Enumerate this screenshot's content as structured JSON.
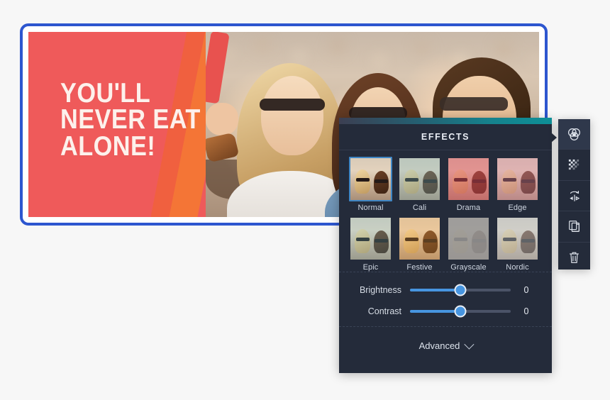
{
  "banner": {
    "headline_lines": [
      "YOU'LL",
      "NEVER EAT",
      "ALONE!"
    ],
    "border_color": "#2d56cf",
    "background_color": "#ef5a5a",
    "stripe_color": "#f47536"
  },
  "effects_panel": {
    "title": "EFFECTS",
    "selected_effect": "Normal",
    "effects": [
      {
        "label": "Normal",
        "tint": "rgba(255,255,255,0)",
        "selected": true
      },
      {
        "label": "Cali",
        "tint": "rgba(120,190,200,0.30)",
        "selected": false
      },
      {
        "label": "Drama",
        "tint": "rgba(224,70,90,0.45)",
        "selected": false
      },
      {
        "label": "Edge",
        "tint": "rgba(215,130,160,0.38)",
        "selected": false
      },
      {
        "label": "Epic",
        "tint": "rgba(110,200,220,0.22)",
        "selected": false
      },
      {
        "label": "Festive",
        "tint": "rgba(255,170,60,0.26)",
        "selected": false
      },
      {
        "label": "Grayscale",
        "tint": "rgba(150,150,150,0.88)",
        "selected": false
      },
      {
        "label": "Nordic",
        "tint": "rgba(180,200,215,0.42)",
        "selected": false
      }
    ],
    "partial_row": [
      {
        "tint": "rgba(190,205,220,0.55)"
      },
      {
        "tint": "rgba(255,205,120,0.48)"
      },
      {
        "tint": "rgba(150,215,225,0.45)"
      },
      {
        "tint": "rgba(205,205,210,0.55)"
      }
    ],
    "sliders": [
      {
        "label": "Brightness",
        "value": "0",
        "percent": 50
      },
      {
        "label": "Contrast",
        "value": "0",
        "percent": 50
      }
    ],
    "advanced_label": "Advanced",
    "accent_color": "#4795e0",
    "panel_bg": "#242b3a"
  },
  "toolbar": {
    "items": [
      {
        "icon": "color-wheel-icon",
        "active": true
      },
      {
        "icon": "checkerboard-transparency-icon",
        "active": false
      },
      {
        "icon": "flip-mirror-icon",
        "active": false
      },
      {
        "icon": "duplicate-icon",
        "active": false
      },
      {
        "icon": "trash-icon",
        "active": false
      }
    ]
  }
}
